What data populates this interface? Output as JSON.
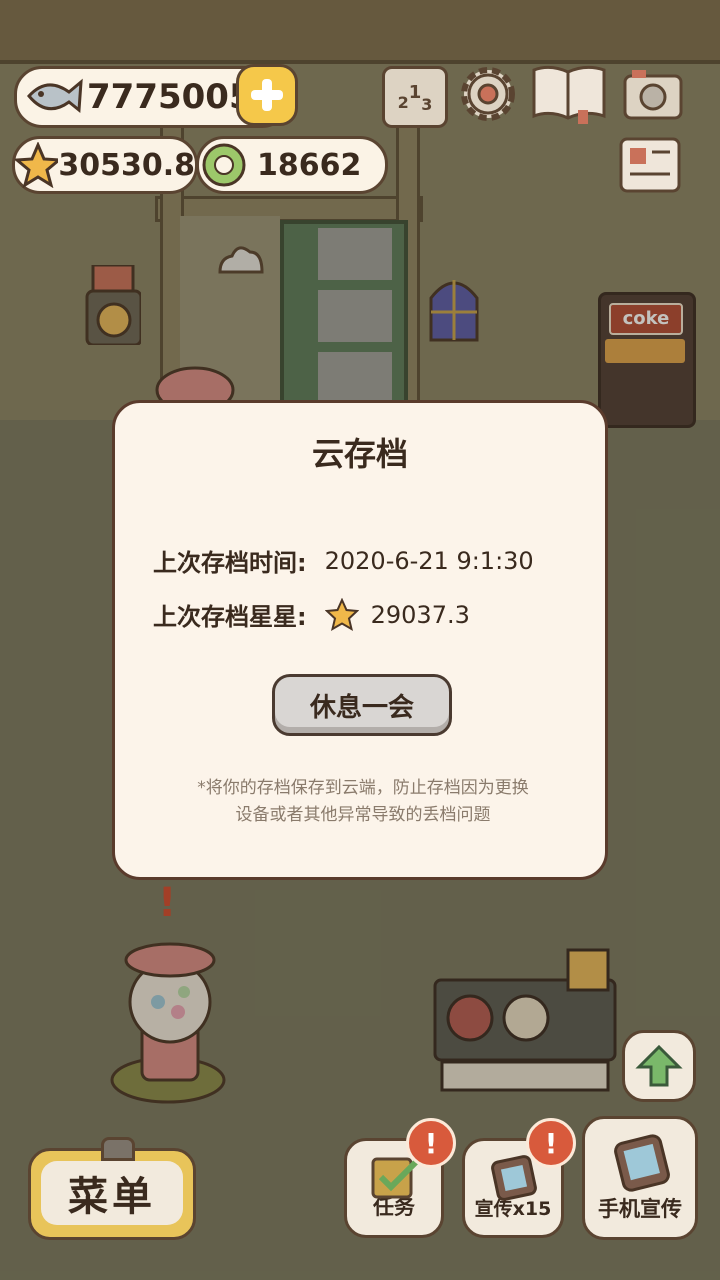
{
  "hud": {
    "fish": "7775005",
    "stars": "30530.8",
    "coins": "18662"
  },
  "icons": {
    "fish": "fish-icon",
    "plus": "plus-icon",
    "star": "star-icon",
    "coin": "coin-icon",
    "ranking": "ranking-icon",
    "settings": "gear-icon",
    "book": "book-icon",
    "camera": "camera-icon",
    "news": "newspaper-icon"
  },
  "ranking_digits": [
    "2",
    "1",
    "3"
  ],
  "dialog": {
    "title": "云存档",
    "last_save_time_label": "上次存档时间:",
    "last_save_time_value": "2020-6-21 9:1:30",
    "last_save_stars_label": "上次存档星星:",
    "last_save_stars_value": "29037.3",
    "rest_button": "休息一会",
    "note_line1": "*将你的存档保存到云端，防止存档因为更换",
    "note_line2": "设备或者其他异常导致的丢档问题"
  },
  "scene": {
    "coke_sign": "coke",
    "exclaim": "!"
  },
  "bottom": {
    "menu": "菜单",
    "tasks": "任务",
    "promo": "宣传x15",
    "phone_promo": "手机宣传",
    "badge": "!"
  },
  "colors": {
    "panel": "#fcf4ea",
    "border": "#5a3b2c",
    "badge": "#d85a3c",
    "star": "#f0b84a",
    "coin": "#9cc86a"
  }
}
